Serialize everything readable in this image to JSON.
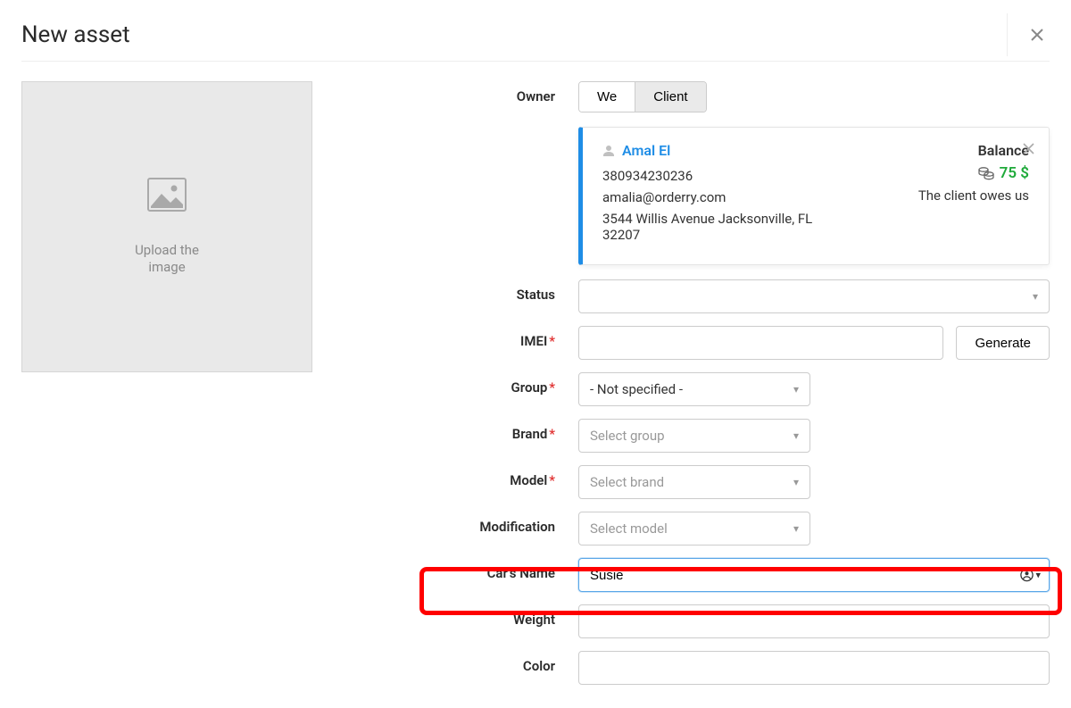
{
  "header": {
    "title": "New asset"
  },
  "upload": {
    "label": "Upload the\nimage"
  },
  "labels": {
    "owner": "Owner",
    "status": "Status",
    "imei": "IMEI",
    "group": "Group",
    "brand": "Brand",
    "model": "Model",
    "modification": "Modification",
    "cars_name": "Car's Name",
    "weight": "Weight",
    "color": "Color"
  },
  "owner_toggle": {
    "we": "We",
    "client": "Client"
  },
  "client": {
    "name": "Amal El",
    "phone": "380934230236",
    "email": "amalia@orderry.com",
    "address": "3544 Willis Avenue Jacksonville, FL 32207",
    "balance_label": "Balance",
    "balance_amount": "75 $",
    "owes_text": "The client owes us"
  },
  "buttons": {
    "generate": "Generate"
  },
  "selects": {
    "status_placeholder": "",
    "group_value": "- Not specified -",
    "brand_placeholder": "Select group",
    "model_placeholder": "Select brand",
    "modification_placeholder": "Select model"
  },
  "cars_name_value": "Susie"
}
